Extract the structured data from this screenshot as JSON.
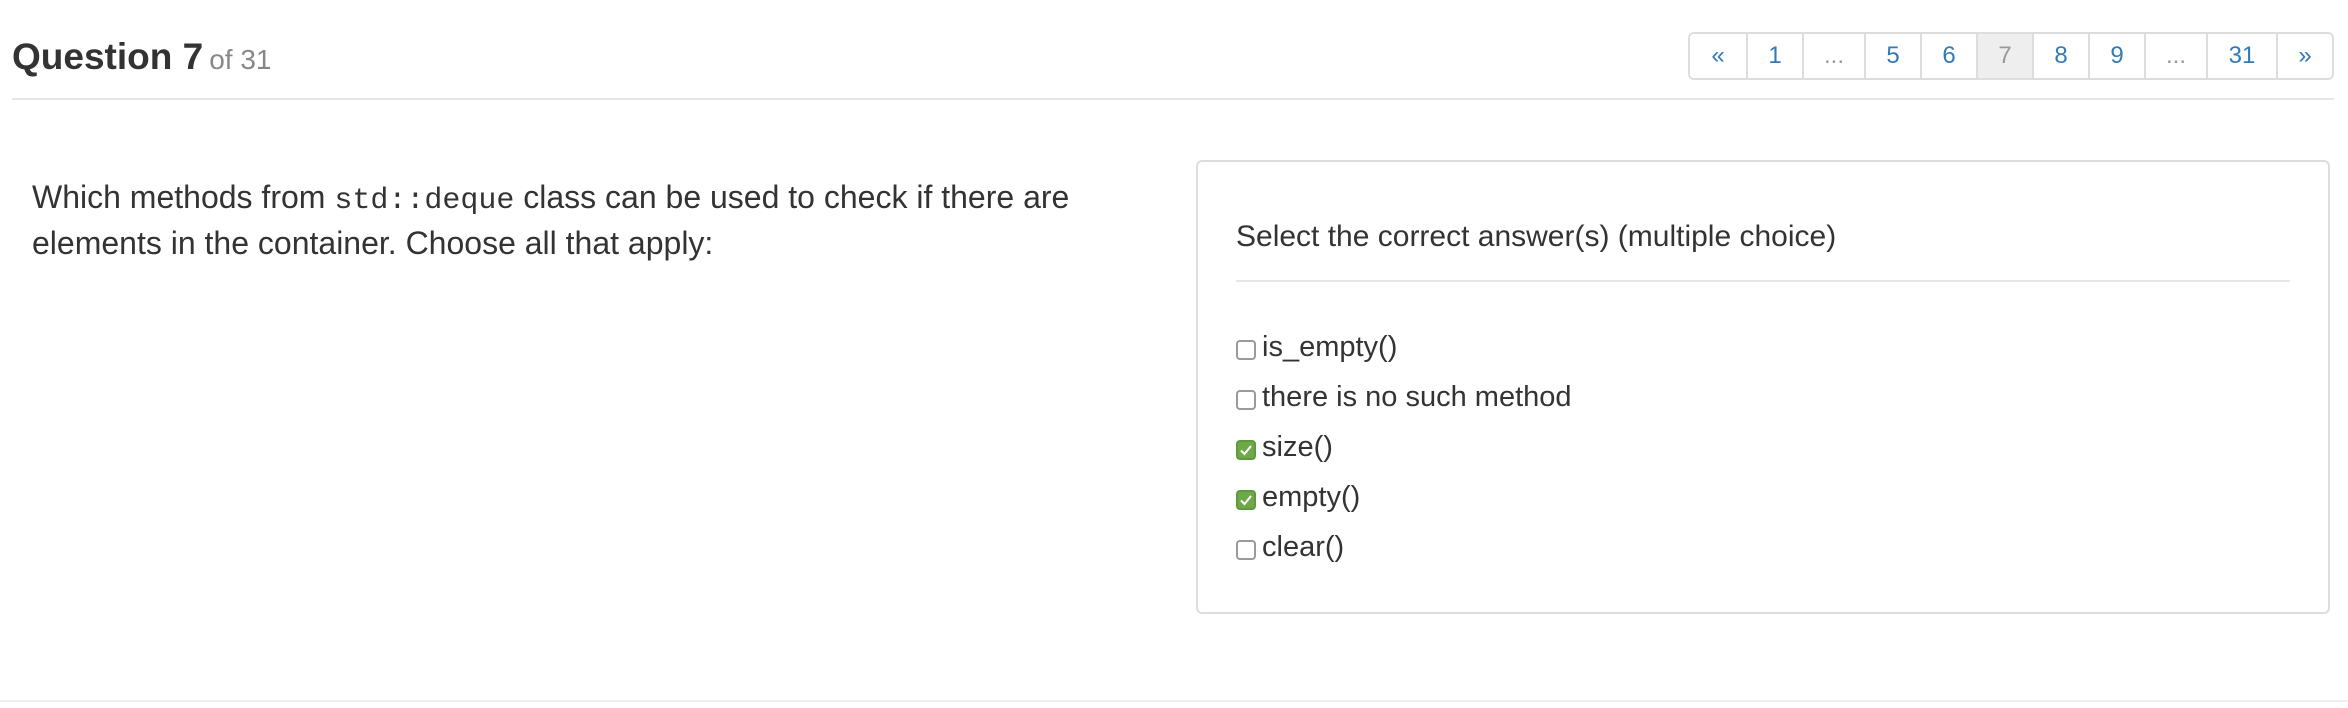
{
  "header": {
    "title": "Question 7",
    "subtitle": "of 31"
  },
  "pagination": [
    {
      "label": "«"
    },
    {
      "label": "1"
    },
    {
      "label": "..."
    },
    {
      "label": "5"
    },
    {
      "label": "6"
    },
    {
      "label": "7",
      "active": true
    },
    {
      "label": "8"
    },
    {
      "label": "9"
    },
    {
      "label": "..."
    },
    {
      "label": "31"
    },
    {
      "label": "»"
    }
  ],
  "question": {
    "text_before": "Which methods from ",
    "code": "std::deque",
    "text_after": " class can be used to check if there are elements in the container. Choose all that apply:"
  },
  "answer_panel": {
    "heading": "Select the correct answer(s) (multiple choice)",
    "options": [
      {
        "label": "is_empty()",
        "checked": false
      },
      {
        "label": "there is no such method",
        "checked": false
      },
      {
        "label": "size()",
        "checked": true
      },
      {
        "label": "empty()",
        "checked": true
      },
      {
        "label": "clear()",
        "checked": false
      }
    ]
  },
  "colors": {
    "link": "#337ab7",
    "checked": "#6fa84a",
    "muted": "#888888"
  }
}
